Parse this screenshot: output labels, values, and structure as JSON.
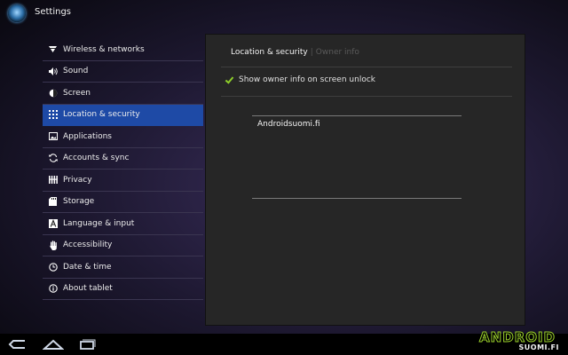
{
  "app": {
    "title": "Settings",
    "icon": "settings-orb-icon"
  },
  "sidebar": {
    "items": [
      {
        "label": "Wireless & networks",
        "icon": "wireless-icon"
      },
      {
        "label": "Sound",
        "icon": "sound-icon"
      },
      {
        "label": "Screen",
        "icon": "screen-icon"
      },
      {
        "label": "Location & security",
        "icon": "location-security-icon",
        "selected": true
      },
      {
        "label": "Applications",
        "icon": "applications-icon"
      },
      {
        "label": "Accounts & sync",
        "icon": "sync-icon"
      },
      {
        "label": "Privacy",
        "icon": "privacy-icon"
      },
      {
        "label": "Storage",
        "icon": "storage-icon"
      },
      {
        "label": "Language & input",
        "icon": "language-icon"
      },
      {
        "label": "Accessibility",
        "icon": "accessibility-icon"
      },
      {
        "label": "Date & time",
        "icon": "clock-icon"
      },
      {
        "label": "About tablet",
        "icon": "info-icon"
      }
    ]
  },
  "panel": {
    "breadcrumb": {
      "current": "Location & security",
      "next": "Owner info"
    },
    "checkbox": {
      "label": "Show owner info on screen unlock",
      "checked": true
    },
    "owner_text": "Androidsuomi.fi"
  },
  "navbar": {
    "buttons": [
      "back-icon",
      "home-icon",
      "recent-apps-icon"
    ]
  },
  "watermark": {
    "word": "ANDROID",
    "sub": "SUOMI.FI"
  },
  "colors": {
    "selection": "#1e4aa6",
    "check": "#8ecf2a",
    "panel_bg": "#262626",
    "logo_accent": "#9ad02a"
  }
}
